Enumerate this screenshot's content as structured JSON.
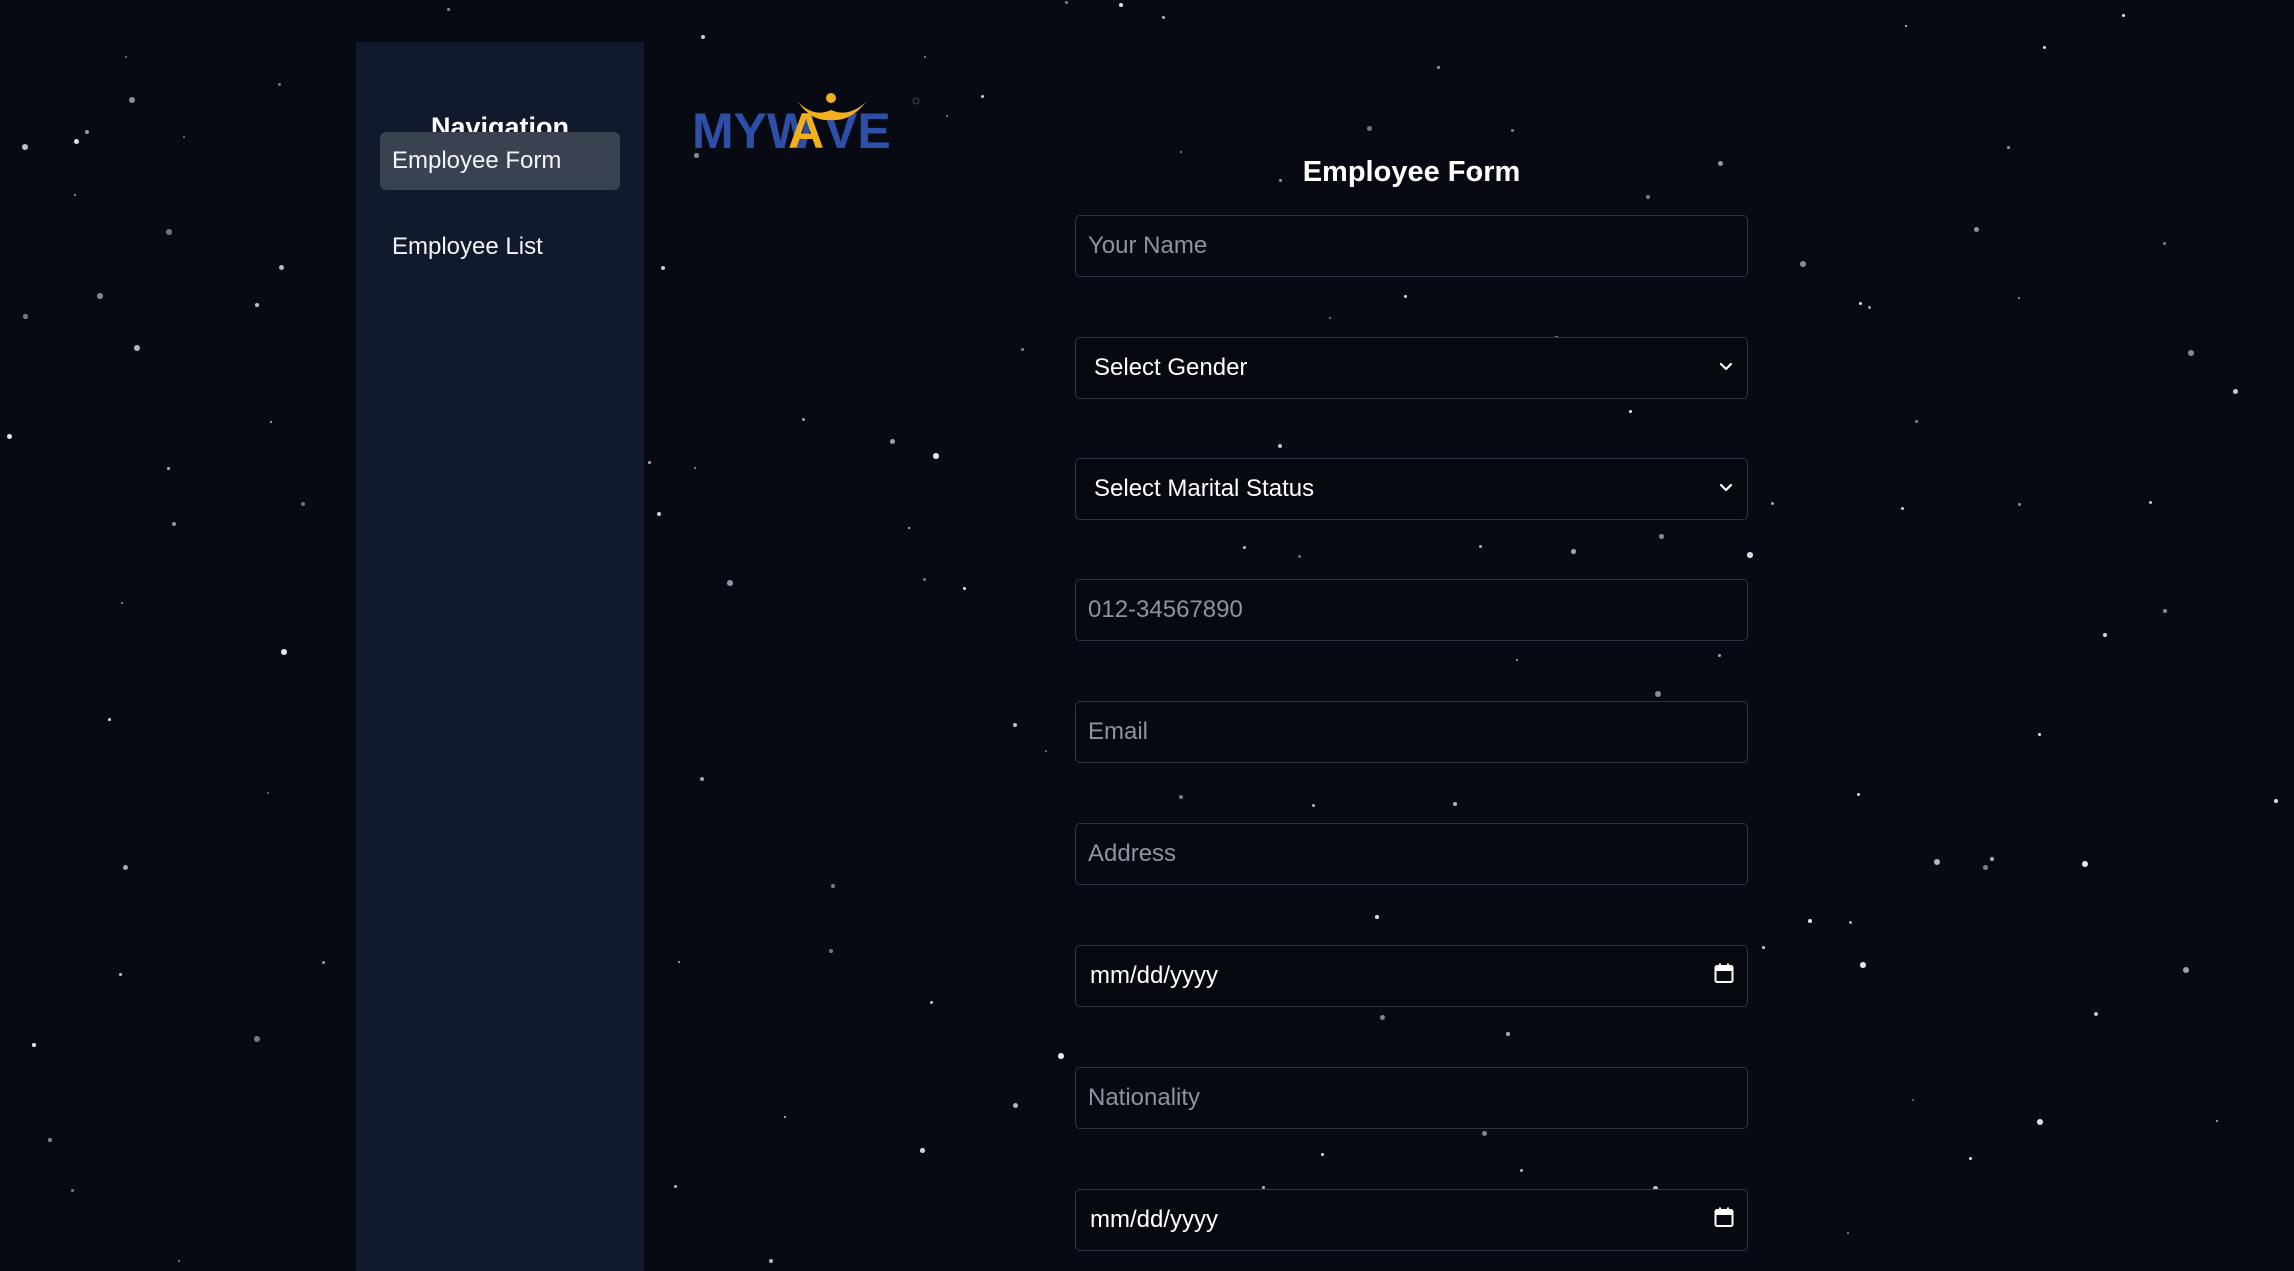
{
  "sidebar": {
    "title": "Navigation",
    "items": [
      {
        "label": "Employee Form",
        "active": true
      },
      {
        "label": "Employee List",
        "active": false
      }
    ]
  },
  "logo": {
    "text_left": "MYW",
    "text_a": "A",
    "text_right": "VE",
    "brand_color": "#2e4fa8",
    "accent_color": "#f2b01e"
  },
  "form": {
    "title": "Employee Form",
    "name_placeholder": "Your Name",
    "gender_selected": "Select Gender",
    "marital_selected": "Select Marital Status",
    "phone_placeholder": "012-34567890",
    "email_placeholder": "Email",
    "address_placeholder": "Address",
    "date1_value": "mm/dd/yyyy",
    "nationality_placeholder": "Nationality",
    "date2_value": "mm/dd/yyyy"
  },
  "colors": {
    "background": "#070a12",
    "sidebar": "#111a2c",
    "active_item": "#3a4252"
  },
  "icons": {
    "select_arrow": "chevron-down-icon",
    "date_picker": "calendar-icon"
  }
}
